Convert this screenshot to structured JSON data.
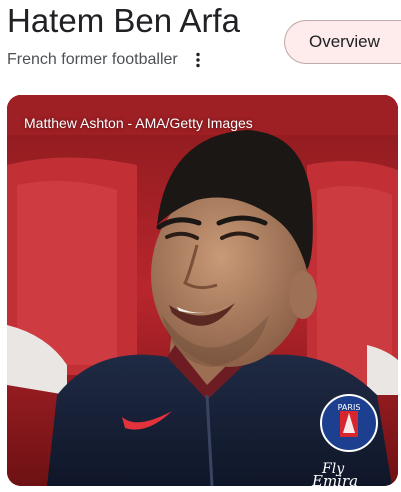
{
  "entity": {
    "title": "Hatem Ben Arfa",
    "subtitle": "French former footballer"
  },
  "actions": {
    "overview_label": "Overview",
    "more_icon": "more-vert-icon"
  },
  "image": {
    "credit": "Matthew Ashton - AMA/Getty Images",
    "jersey_text": "Fly Emirates",
    "badge_text": "PARIS",
    "description_icon": "person-photo"
  },
  "colors": {
    "overview_bg": "#fdeceb",
    "overview_border": "#c0a9a8",
    "title_text": "#202124",
    "subtitle_text": "#4d5156"
  }
}
